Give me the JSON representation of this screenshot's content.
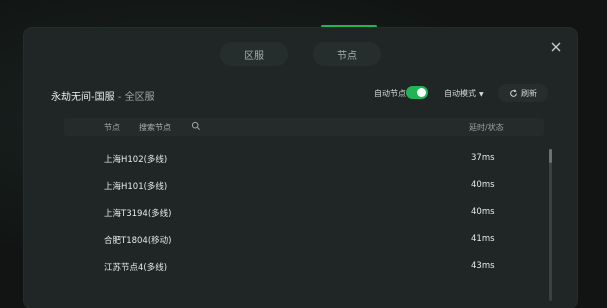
{
  "tabs": {
    "region": "区服",
    "node": "节点"
  },
  "title": {
    "game": "永劫无间-国服",
    "separator": " - ",
    "scope": "全区服"
  },
  "controls": {
    "auto_node_label": "自动节点",
    "auto_node_enabled": true,
    "auto_mode_label": "自动模式",
    "auto_mode_caret": "▼",
    "refresh_label": "刷新"
  },
  "table": {
    "col_node": "节点",
    "search_placeholder": "搜索节点",
    "col_latency": "延时/状态",
    "rows": [
      {
        "name": "上海H102(多线)",
        "latency": "37ms"
      },
      {
        "name": "上海H101(多线)",
        "latency": "40ms"
      },
      {
        "name": "上海T3194(多线)",
        "latency": "40ms"
      },
      {
        "name": "合肥T1804(移动)",
        "latency": "41ms"
      },
      {
        "name": "江苏节点4(多线)",
        "latency": "43ms"
      }
    ]
  },
  "colors": {
    "accent": "#25b35a",
    "panel": "#1f2625"
  },
  "icons": {
    "close": "close-icon",
    "search": "search-icon",
    "refresh": "refresh-icon"
  }
}
